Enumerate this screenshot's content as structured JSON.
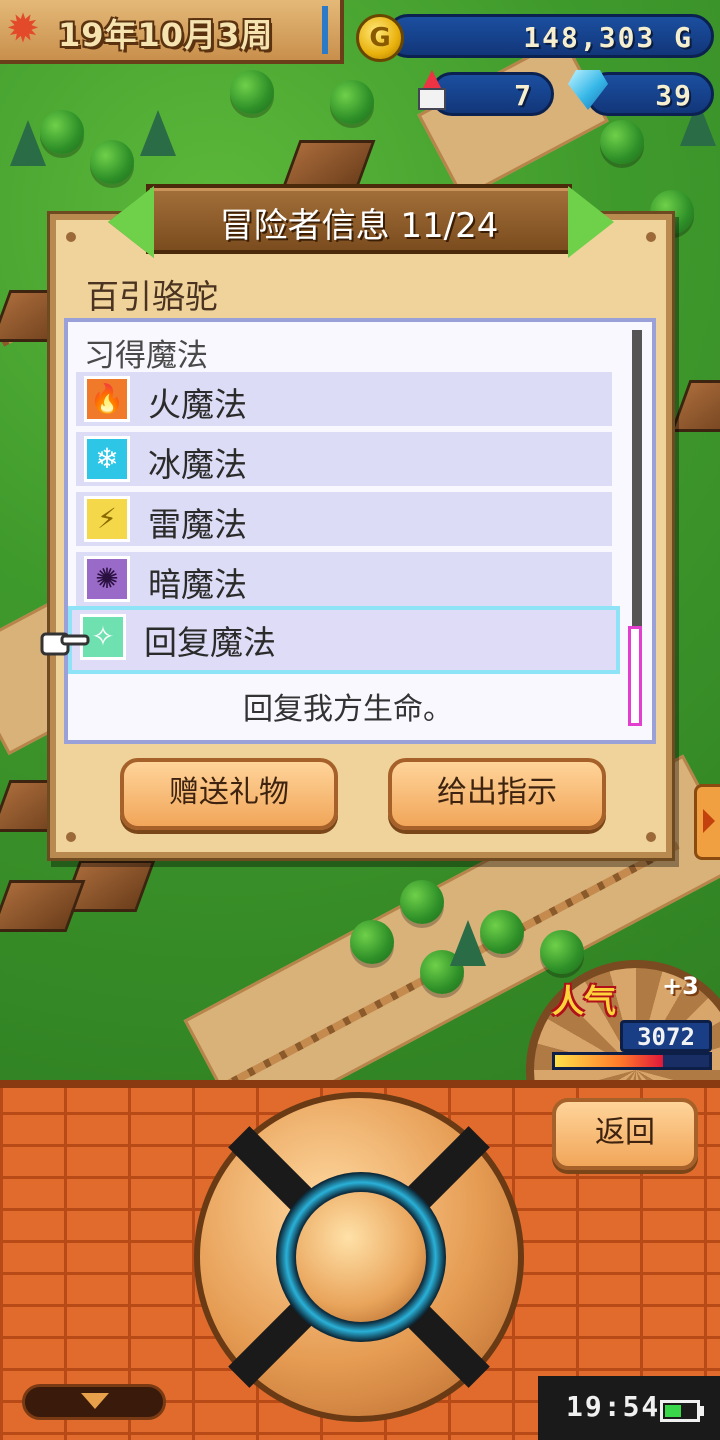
{
  "hud": {
    "date": "19年10月3周",
    "gold": "148,303 G",
    "town_count": "7",
    "gem_count": "39"
  },
  "dialog": {
    "title": "冒险者信息 11/24",
    "adventurer_name": "百引骆驼",
    "section_heading": "习得魔法",
    "magics": [
      {
        "label": "火魔法",
        "icon": "fire-icon",
        "color": "#f07a2a",
        "glyph": "🔥"
      },
      {
        "label": "冰魔法",
        "icon": "ice-icon",
        "color": "#2ec6e6",
        "glyph": "❄"
      },
      {
        "label": "雷魔法",
        "icon": "lightning-icon",
        "color": "#f4d84a",
        "glyph": "⚡"
      },
      {
        "label": "暗魔法",
        "icon": "dark-vortex-icon",
        "color": "#7a4aa8",
        "glyph": "✺"
      },
      {
        "label": "回复魔法",
        "icon": "sparkle-heal-icon",
        "color": "#6fe0b0",
        "glyph": "✧"
      }
    ],
    "selected_description": "回复我方生命。",
    "buttons": {
      "gift": "赠送礼物",
      "instruct": "给出指示"
    }
  },
  "popularity": {
    "label": "人气",
    "delta": "+3",
    "value": "3072",
    "bar_fraction": 0.7
  },
  "controls": {
    "back": "返回"
  },
  "status": {
    "time": "19:54",
    "battery_fraction": 0.6
  },
  "colors": {
    "brick": "#e06b2c",
    "dialog_bg": "#f0d39a",
    "banner": "#8a5a28",
    "arrow_green": "#6fd04a",
    "selection_outline": "#8fe3f6",
    "scroll_thumb": "#e23fd0"
  }
}
